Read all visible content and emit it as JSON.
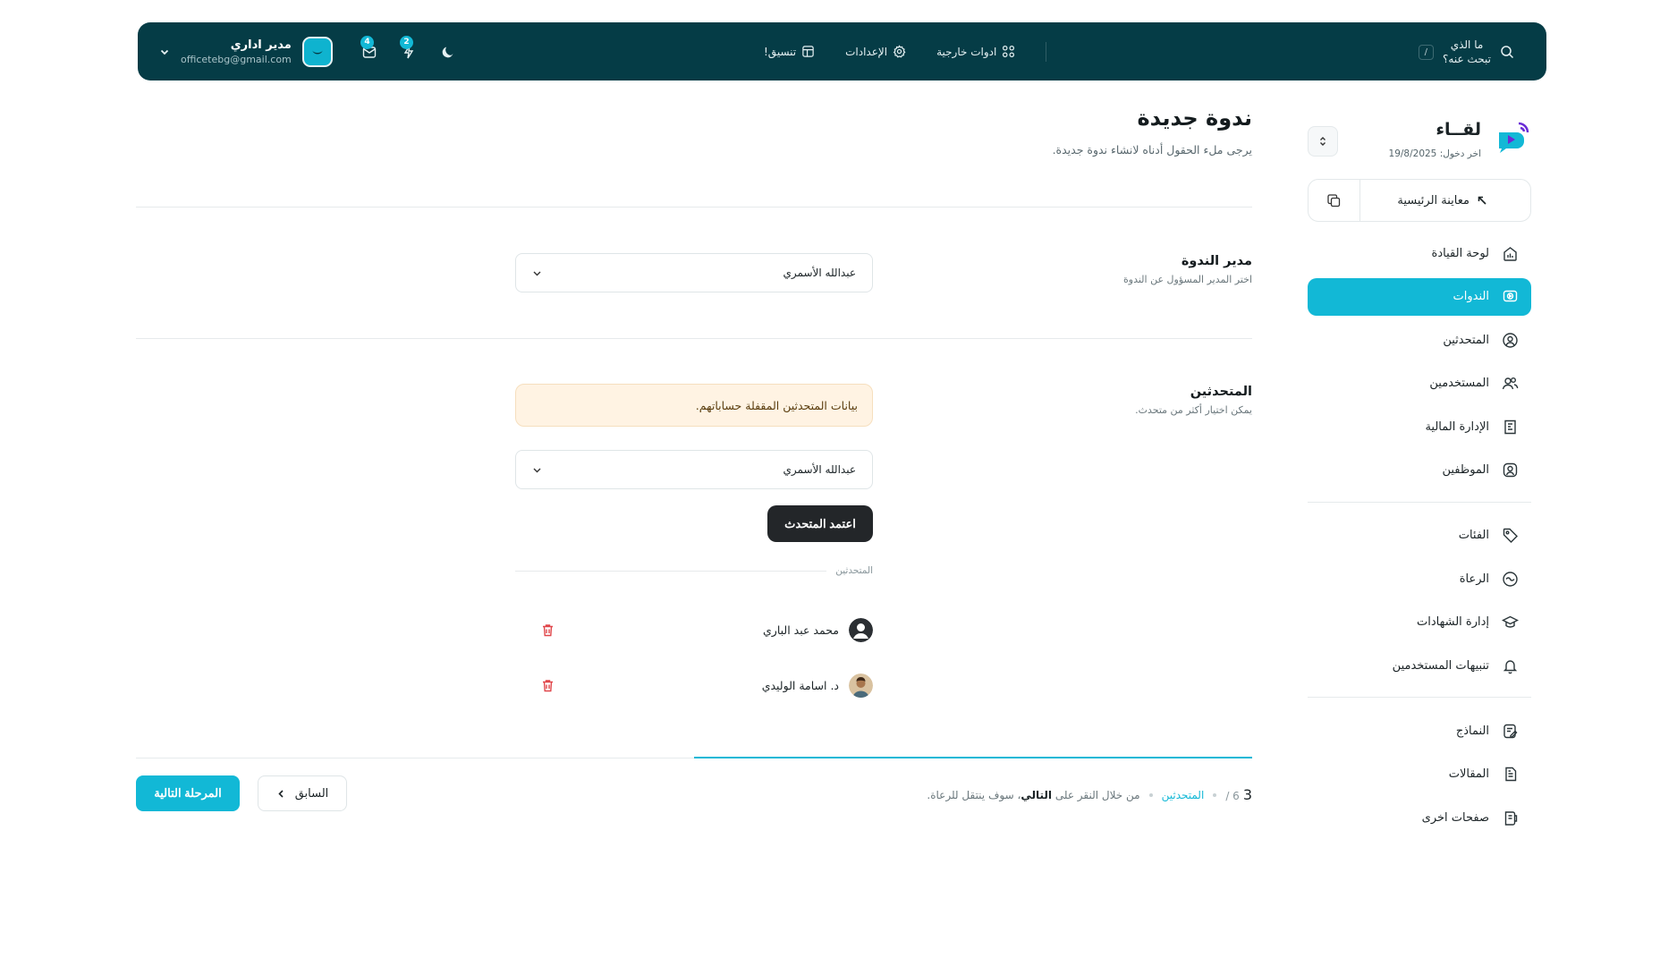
{
  "topbar": {
    "search_text": "ما الذي تبحث عنه؟",
    "search_shortcut": "/",
    "links": [
      {
        "label": "تنسيق!",
        "icon": "layout-icon"
      },
      {
        "label": "الإعدادات",
        "icon": "gear-icon"
      },
      {
        "label": "ادوات خارجية",
        "icon": "apps-grid-icon"
      }
    ],
    "mail_badge": "4",
    "tools_badge": "2",
    "user_name": "مدير اداري",
    "user_email": "officetebg@gmail.com"
  },
  "sidebar": {
    "brand_name": "لقــاء",
    "last_login": "اخر دخول: 19/8/2025",
    "preview_label": "معاينة الرئيسية",
    "group1": [
      {
        "label": "لوحة القيادة",
        "icon": "dashboard-icon"
      },
      {
        "label": "الندوات",
        "icon": "video-icon"
      },
      {
        "label": "المتحدثين",
        "icon": "user-circle-icon"
      },
      {
        "label": "المستخدمين",
        "icon": "users-icon"
      },
      {
        "label": "الإدارة المالية",
        "icon": "receipt-icon"
      },
      {
        "label": "الموظفين",
        "icon": "user-square-icon"
      }
    ],
    "group2": [
      {
        "label": "الفئات",
        "icon": "tag-icon"
      },
      {
        "label": "الرعاة",
        "icon": "sponsor-icon"
      },
      {
        "label": "إدارة الشهادات",
        "icon": "graduation-cap-icon"
      },
      {
        "label": "تنبيهات المستخدمين",
        "icon": "bell-icon"
      }
    ],
    "group3": [
      {
        "label": "النماذج",
        "icon": "form-icon"
      },
      {
        "label": "المقالات",
        "icon": "article-icon"
      },
      {
        "label": "صفحات اخرى",
        "icon": "pages-icon"
      }
    ],
    "active_item": "الندوات"
  },
  "main": {
    "title": "ندوة جديدة",
    "subtitle": "يرجى ملء الحقول أدناه لانشاء ندوة جديدة.",
    "manager": {
      "label": "مدير الندوة",
      "hint": "اختر المدير المسؤول عن الندوة",
      "value": "عبدالله الأسمري"
    },
    "speakers": {
      "label": "المتحدثين",
      "hint": "يمكن اختيار أكثر من متحدث.",
      "alert": "بيانات المتحدثين المقفلة حساباتهم.",
      "select_value": "عبدالله الأسمري",
      "approve_label": "اعتمد المتحدث",
      "list_title": "المتحدثين",
      "list": [
        {
          "name": "محمد عبد الباري",
          "avatar": "default-avatar"
        },
        {
          "name": "د. اسامة الوليدي",
          "avatar": "photo-avatar"
        }
      ]
    },
    "footer": {
      "step_current": "3",
      "step_total": "/ 6",
      "current_step_name": "المتحدثين",
      "hint_prefix": "من خلال النقر على",
      "hint_bold": "التالي",
      "hint_suffix": "سوف ينتقل للرعاة.",
      "prev_label": "السابق",
      "next_label": "المرحلة التالية",
      "progress": 0.5
    }
  },
  "colors": {
    "topbar_bg": "#053c46",
    "accent": "#12b8d6",
    "alert_bg": "#fff3e3",
    "danger": "#e0464a",
    "dark_button": "#232629"
  }
}
